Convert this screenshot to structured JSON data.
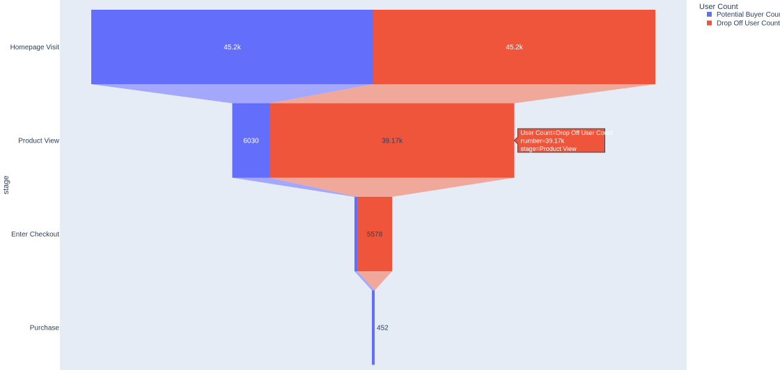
{
  "chart_data": {
    "type": "funnel",
    "stages": [
      "Homepage Visit",
      "Product View",
      "Enter Checkout",
      "Purchase"
    ],
    "ylabel": "stage",
    "legend_title": "User Count",
    "legend_position": "top-right",
    "series": [
      {
        "name": "Potential Buyer Count",
        "color": "#636efa",
        "values": [
          45200,
          6030,
          452,
          452
        ],
        "labels": [
          "45.2k",
          "6030",
          "",
          "452"
        ]
      },
      {
        "name": "Drop Off User Count",
        "color": "#ef553b",
        "values": [
          45200,
          39170,
          5578,
          0
        ],
        "labels": [
          "45.2k",
          "39.17k",
          "5578",
          ""
        ]
      }
    ],
    "hover": {
      "series": 1,
      "stage": 1,
      "lines": [
        "User Count=Drop Off User Count",
        "number=39.17k",
        "stage=Product View"
      ]
    },
    "plot_bgcolor": "#e5ecf6",
    "connector_colors": [
      "#a3a8fc",
      "#f0a89b"
    ]
  }
}
